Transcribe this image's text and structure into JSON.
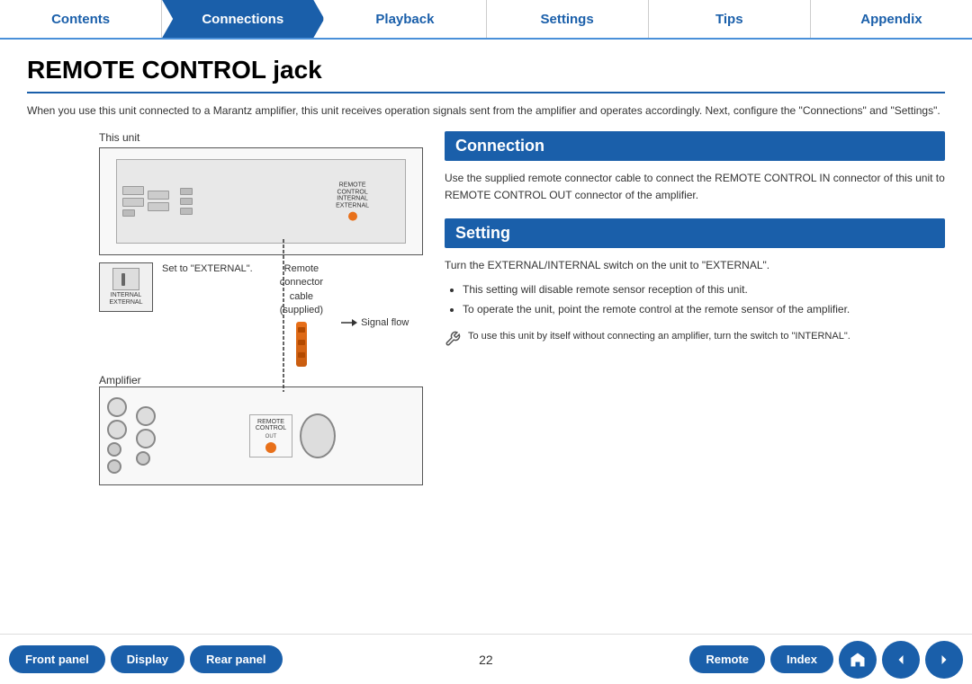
{
  "nav": {
    "tabs": [
      {
        "label": "Contents",
        "active": false
      },
      {
        "label": "Connections",
        "active": true
      },
      {
        "label": "Playback",
        "active": false
      },
      {
        "label": "Settings",
        "active": false
      },
      {
        "label": "Tips",
        "active": false
      },
      {
        "label": "Appendix",
        "active": false
      }
    ]
  },
  "page": {
    "title": "REMOTE CONTROL jack",
    "intro": "When you use this unit connected to a Marantz amplifier, this unit receives operation signals sent from the amplifier and operates accordingly. Next, configure the \"Connections\" and \"Settings\"."
  },
  "diagram": {
    "this_unit_label": "This unit",
    "switch_labels": "INTERNAL\nEXTERNAL",
    "set_to_label": "Set to\n\"EXTERNAL\".",
    "remote_connector_label": "Remote\nconnector\ncable\n(supplied)",
    "signal_flow_label": "Signal flow",
    "amplifier_label": "Amplifier"
  },
  "connection_section": {
    "header": "Connection",
    "text": "Use the supplied remote connector cable to connect the REMOTE CONTROL IN connector of this unit to REMOTE CONTROL OUT connector of the amplifier."
  },
  "setting_section": {
    "header": "Setting",
    "main_text": "Turn the EXTERNAL/INTERNAL switch on the unit to \"EXTERNAL\".",
    "bullets": [
      "This setting will disable remote sensor reception of this unit.",
      "To operate the unit, point the remote control at the remote sensor of the amplifier."
    ],
    "note": "To use this unit by itself without connecting an amplifier, turn the switch to \"INTERNAL\"."
  },
  "bottom_nav": {
    "front_panel": "Front panel",
    "display": "Display",
    "rear_panel": "Rear panel",
    "page_number": "22",
    "remote": "Remote",
    "index": "Index"
  }
}
